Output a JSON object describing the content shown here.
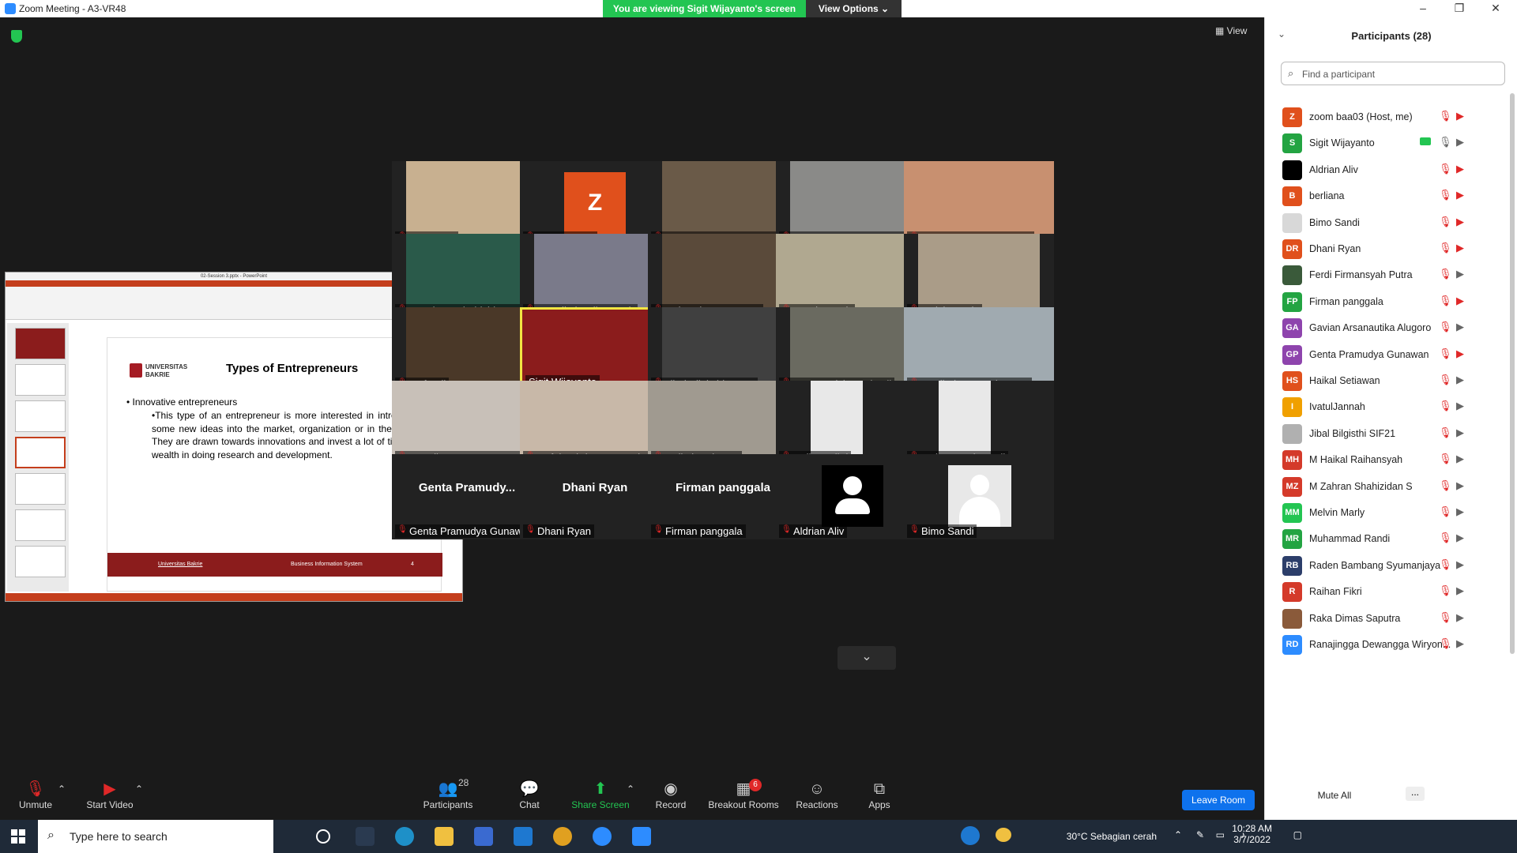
{
  "window": {
    "title": "Zoom Meeting - A3-VR48",
    "sharing_text": "You are viewing Sigit Wijayanto's screen",
    "view_options": "View Options",
    "view_label": "View"
  },
  "slide": {
    "window_title": "02-Session 3.pptx - PowerPoint",
    "logo_text": "UNIVERSITAS BAKRIE",
    "title": "Types of Entrepreneurs",
    "bullet": "• Innovative entrepreneurs",
    "sub_bullet": "•This type of an entrepreneur is more interested in introducing some new ideas into the market, organization or in the nation. They are drawn towards innovations and invest a lot of time and wealth in doing research and development.",
    "footer_left": "Universitas Bakrie",
    "footer_mid": "Business Information System",
    "footer_page": "4"
  },
  "tiles": [
    {
      "name": "wibi surya"
    },
    {
      "name": "zoom baa03"
    },
    {
      "name": "Gavian Arsanautika Alugoro"
    },
    {
      "name": "Raden Bambang Syumanja..."
    },
    {
      "name": "SIF_Muhammad Fabian"
    },
    {
      "name": "M Zahran Shahizidan S"
    },
    {
      "name": "M Haikal Raihansyah"
    },
    {
      "name": "Raka Dimas Saputra"
    },
    {
      "name": "IvatulJannah"
    },
    {
      "name": "Melvin Marly"
    },
    {
      "name": "rusfandi"
    },
    {
      "name": "Sigit Wijayanto"
    },
    {
      "name": "Jibal Bilgisthi SIF21"
    },
    {
      "name": "Yusran Rizky Mulyadi"
    },
    {
      "name": "Ferdi Firmansyah Putra"
    },
    {
      "name": "Ranajingga Dewangga Wir..."
    },
    {
      "name": "Refal Fahriza Ramanda"
    },
    {
      "name": "Haikal Setiawan"
    },
    {
      "name": "Raihan Fikri"
    },
    {
      "name": "Muhammad Randi"
    },
    {
      "name": "Genta Pramudya Gunawan",
      "big": "Genta  Pramudy..."
    },
    {
      "name": "Dhani Ryan",
      "big": "Dhani Ryan"
    },
    {
      "name": "Firman panggala",
      "big": "Firman panggala"
    },
    {
      "name": "Aldrian Aliv"
    },
    {
      "name": "Bimo Sandi"
    }
  ],
  "zoom_tile_letter": "Z",
  "toolbar": {
    "unmute": "Unmute",
    "start_video": "Start Video",
    "participants": "Participants",
    "participants_count": "28",
    "chat": "Chat",
    "share_screen": "Share Screen",
    "record": "Record",
    "breakout": "Breakout Rooms",
    "breakout_badge": "6",
    "reactions": "Reactions",
    "apps": "Apps",
    "leave": "Leave Room"
  },
  "panel": {
    "title": "Participants (28)",
    "search_placeholder": "Find a participant",
    "mute_all": "Mute All",
    "more": "...",
    "participants": [
      {
        "initials": "Z",
        "name": "zoom baa03 (Host, me)",
        "color": "#e0501c"
      },
      {
        "initials": "S",
        "name": "Sigit Wijayanto",
        "color": "#23a442"
      },
      {
        "initials": "",
        "name": "Aldrian Aliv",
        "color": "#000000"
      },
      {
        "initials": "B",
        "name": "berliana",
        "color": "#e0501c"
      },
      {
        "initials": "",
        "name": "Bimo Sandi",
        "color": "#d8d8d8"
      },
      {
        "initials": "DR",
        "name": "Dhani Ryan",
        "color": "#e0501c"
      },
      {
        "initials": "",
        "name": "Ferdi Firmansyah Putra",
        "color": "#3a5a3a"
      },
      {
        "initials": "FP",
        "name": "Firman panggala",
        "color": "#23a442"
      },
      {
        "initials": "GA",
        "name": "Gavian Arsanautika Alugoro",
        "color": "#8e44ad"
      },
      {
        "initials": "GP",
        "name": "Genta Pramudya Gunawan",
        "color": "#8e44ad"
      },
      {
        "initials": "HS",
        "name": "Haikal Setiawan",
        "color": "#e0501c"
      },
      {
        "initials": "I",
        "name": "IvatulJannah",
        "color": "#f0a000"
      },
      {
        "initials": "",
        "name": "Jibal Bilgisthi SIF21",
        "color": "#b0b0b0"
      },
      {
        "initials": "MH",
        "name": "M Haikal Raihansyah",
        "color": "#d43a2a"
      },
      {
        "initials": "MZ",
        "name": "M Zahran Shahizidan S",
        "color": "#d43a2a"
      },
      {
        "initials": "MM",
        "name": "Melvin Marly",
        "color": "#23c552"
      },
      {
        "initials": "MR",
        "name": "Muhammad Randi",
        "color": "#23a442"
      },
      {
        "initials": "RB",
        "name": "Raden Bambang Syumanjaya",
        "color": "#2c3e6a"
      },
      {
        "initials": "R",
        "name": "Raihan Fikri",
        "color": "#d43a2a"
      },
      {
        "initials": "",
        "name": "Raka Dimas Saputra",
        "color": "#8a5a3a"
      },
      {
        "initials": "RD",
        "name": "Ranajingga Dewangga Wiryon...",
        "color": "#2d8cff"
      }
    ]
  },
  "taskbar": {
    "search_placeholder": "Type here to search",
    "weather": "30°C  Sebagian cerah",
    "time": "10:28 AM",
    "date": "3/7/2022"
  }
}
